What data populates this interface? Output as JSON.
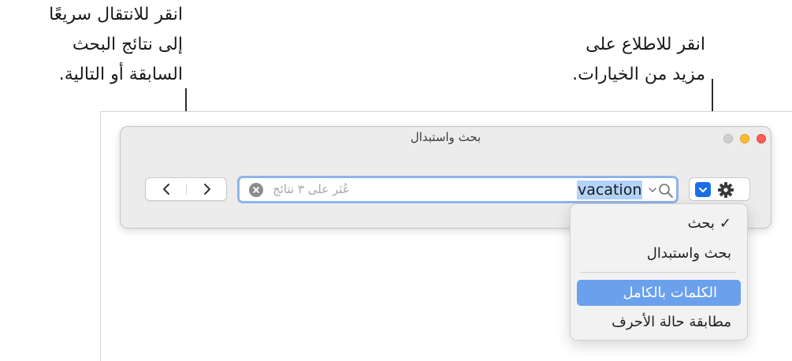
{
  "callouts": {
    "nav": {
      "line1": "انقر للانتقال سريعًا",
      "line2": "إلى نتائج البحث",
      "line3": "السابقة أو التالية."
    },
    "options": {
      "line1": "انقر للاطلاع على",
      "line2": "مزيد من الخيارات."
    }
  },
  "window": {
    "title": "بحث واستبدال"
  },
  "nav": {
    "prev_icon": "chevron-left-icon",
    "next_icon": "chevron-right-icon"
  },
  "search": {
    "query": "vacation",
    "result_count": "عُثر على ٣ نتائج"
  },
  "options_menu": {
    "items": [
      {
        "label": "بحث",
        "checked": true
      },
      {
        "label": "بحث واستبدال"
      },
      {
        "label": "الكلمات بالكامل",
        "highlighted": true
      },
      {
        "label": "مطابقة حالة الأحرف"
      }
    ]
  },
  "colors": {
    "accent": "#1a6ee8",
    "highlight": "#6aa0ec",
    "search_focus": "#8db5ea",
    "query_selection": "#b4d3fb",
    "traffic_close": "#fe5f57",
    "traffic_minimize": "#febc2e"
  }
}
